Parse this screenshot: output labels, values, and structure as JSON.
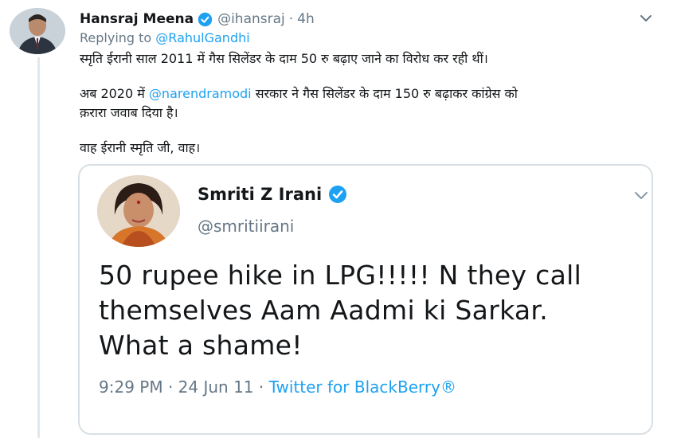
{
  "tweet": {
    "author_name": "Hansraj Meena",
    "handle": "@ihansraj",
    "separator": "·",
    "time": "4h",
    "replying_prefix": "Replying to",
    "replying_to": "@RahulGandhi",
    "line1": "स्मृति ईरानी साल 2011 में गैस सिलेंडर के दाम 50 रु बढ़ाए जाने का विरोध कर रही थीं।",
    "line2_pre": "अब 2020 में",
    "line2_mention": "@narendramodi",
    "line2_post": "सरकार ने गैस सिलेंडर के दाम 150 रु बढ़ाकर कांग्रेस को",
    "line3": "क़रारा जवाब दिया है।",
    "line4": "वाह ईरानी स्मृति जी, वाह।"
  },
  "quote": {
    "author_name": "Smriti Z Irani",
    "handle": "@smritiirani",
    "text_line1": "50 rupee hike in LPG!!!!! N they call",
    "text_line2": "themselves Aam Aadmi ki Sarkar.",
    "text_line3": "What a shame!",
    "time": "9:29 PM",
    "separator": "·",
    "date": "24 Jun 11",
    "source": "Twitter for BlackBerry®"
  },
  "colors": {
    "link": "#1da1f2",
    "secondary_text": "#657786",
    "primary_text": "#14171a",
    "border": "#d8dfe4"
  },
  "icons": {
    "verified": "verified-badge-icon",
    "menu": "chevron-down-icon"
  }
}
